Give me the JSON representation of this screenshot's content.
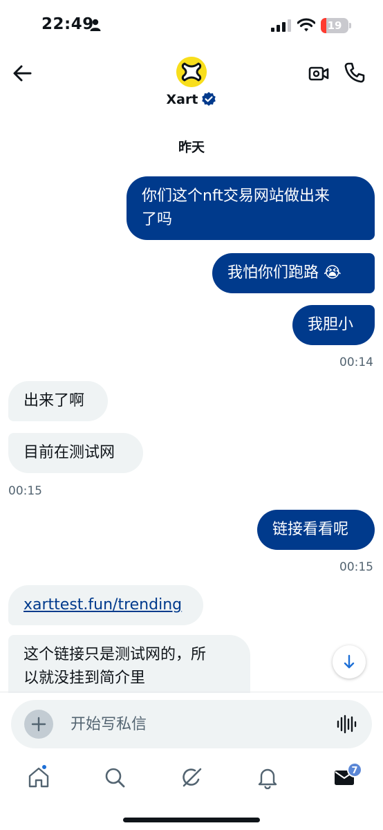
{
  "status_bar": {
    "time": "22:49",
    "battery": "19",
    "battery_fraction": 0.19
  },
  "header": {
    "contact_name": "Xart",
    "verified": true
  },
  "conversation": {
    "date_separator": "昨天",
    "messages": [
      {
        "direction": "sent",
        "text": "你们这个nft交易网站做出来了吗"
      },
      {
        "direction": "sent",
        "text": "我怕你们跑路 😭"
      },
      {
        "direction": "sent",
        "text": "我胆小",
        "time": "00:14"
      },
      {
        "direction": "received",
        "text": "出来了啊"
      },
      {
        "direction": "received",
        "text": "目前在测试网",
        "time": "00:15"
      },
      {
        "direction": "sent",
        "text": "链接看看呢",
        "time": "00:15"
      },
      {
        "direction": "received",
        "text": "xarttest.fun/trending",
        "is_link": true
      },
      {
        "direction": "received",
        "text": "这个链接只是测试网的，所以就没挂到简介里"
      }
    ],
    "msg1_line1": "你们这个nft交易网站做出来",
    "msg1_line2": "了吗",
    "msg8_line1": "这个链接只是测试网的，所",
    "msg8_line2": "以就没挂到简介里"
  },
  "composer": {
    "placeholder": "开始写私信"
  },
  "tab_bar": {
    "items": [
      "home-icon",
      "search-icon",
      "grok-icon",
      "notifications-icon",
      "messages-icon"
    ],
    "messages_badge": "7"
  },
  "colors": {
    "sent_bubble": "#003a8c",
    "received_bubble": "#eff3f4",
    "avatar_bg": "#f8de1c",
    "link": "#003a8c"
  }
}
